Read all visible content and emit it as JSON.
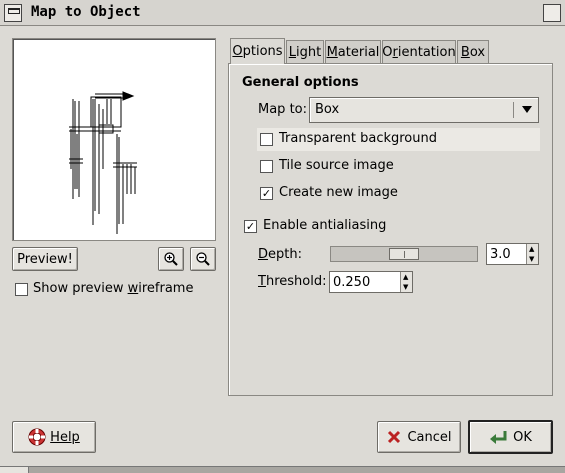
{
  "window": {
    "title": "Map to Object"
  },
  "preview": {
    "preview_button": "Preview!",
    "show_wireframe_prefix": "Show preview ",
    "show_wireframe_underlined": "w",
    "show_wireframe_suffix": "ireframe",
    "show_wireframe_checked": false
  },
  "tabs": [
    {
      "u": "O",
      "rest": "ptions",
      "active": true
    },
    {
      "u": "L",
      "rest": "ight",
      "active": false
    },
    {
      "u": "M",
      "rest": "aterial",
      "active": false
    },
    {
      "pre": "O",
      "u": "r",
      "rest": "ientation",
      "active": false
    },
    {
      "u": "B",
      "rest": "ox",
      "active": false
    }
  ],
  "options": {
    "section_title": "General options",
    "map_to_label": "Map to:",
    "map_to_value": "Box",
    "transparent_bg": {
      "label": "Transparent background",
      "checked": false
    },
    "tile_source": {
      "label": "Tile source image",
      "checked": false
    },
    "create_new": {
      "label": "Create new image",
      "checked": true
    },
    "antialiasing": {
      "label": "Enable antialiasing",
      "checked": true
    },
    "depth": {
      "u": "D",
      "rest": "epth:",
      "value": "3.0"
    },
    "threshold": {
      "u": "T",
      "rest": "hreshold:",
      "value": "0.250"
    }
  },
  "footer": {
    "help": "Help",
    "cancel": "Cancel",
    "ok": "OK"
  }
}
